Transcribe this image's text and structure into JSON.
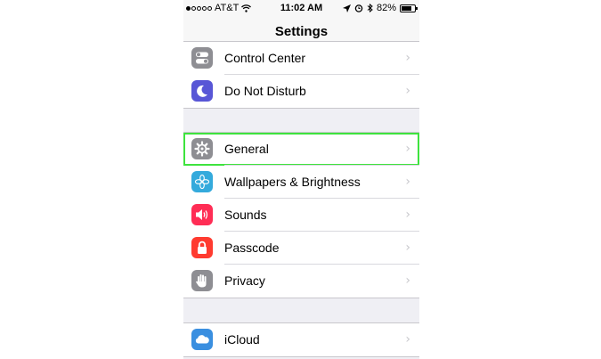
{
  "status": {
    "carrier": "AT&T",
    "time": "11:02 AM",
    "battery": "82%",
    "battery_level": 0.82
  },
  "nav": {
    "title": "Settings"
  },
  "colors": {
    "control_center": "#8e8e93",
    "do_not_disturb": "#5856d6",
    "general": "#8e8e93",
    "wallpapers": "#34aadc",
    "sounds": "#ff2d55",
    "passcode": "#ff3b30",
    "privacy": "#8e8e93",
    "icloud": "#3a8fe0",
    "highlight": "#3ee33e"
  },
  "rows": {
    "control_center": "Control Center",
    "do_not_disturb": "Do Not Disturb",
    "general": "General",
    "wallpapers": "Wallpapers & Brightness",
    "sounds": "Sounds",
    "passcode": "Passcode",
    "privacy": "Privacy",
    "icloud": "iCloud"
  },
  "chevron": "›"
}
